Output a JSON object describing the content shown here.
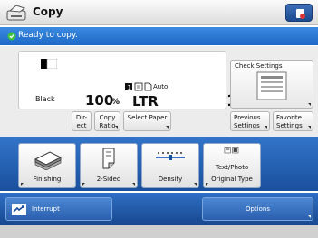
{
  "header": {
    "title": "Copy",
    "app_icon": "copier-icon",
    "corner_icon": "gear-icon"
  },
  "status": {
    "text": "Ready to copy.",
    "icon": "check-circle-icon"
  },
  "settings": {
    "color_mode": "Black",
    "ratio_value": "100",
    "ratio_unit": "%",
    "paper_auto": "Auto",
    "paper_size": "LTR",
    "copies": "1"
  },
  "buttons": {
    "direct": "Dir-\nect",
    "copy_ratio": "Copy\nRatio",
    "select_paper": "Select Paper",
    "check_settings": "Check Settings",
    "previous_settings": "Previous\nSettings",
    "favorite_settings": "Favorite\nSettings"
  },
  "functions": {
    "finishing": "Finishing",
    "two_sided": "2-Sided",
    "density": "Density",
    "original_type_value": "Text/Photo",
    "original_type": "Original Type"
  },
  "bottom": {
    "interrupt": "Interrupt",
    "options": "Options"
  },
  "colors": {
    "accent": "#1e68c8",
    "panel": "#ececec"
  }
}
